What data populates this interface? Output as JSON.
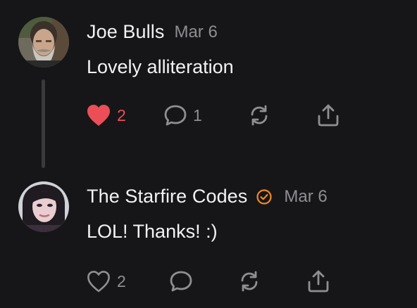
{
  "colors": {
    "background": "#161618",
    "text_primary": "#f3f3f5",
    "text_secondary": "#8e8e93",
    "like_active": "#ec4e57",
    "verified_badge": "#f08a24",
    "thread_line": "#3a3a3d"
  },
  "posts": [
    {
      "author": "Joe Bulls",
      "date": "Mar 6",
      "text": "Lovely alliteration",
      "verified": false,
      "avatar_icon": "bearded-man-avatar",
      "actions": {
        "like": {
          "icon": "heart-filled-icon",
          "count": "2",
          "liked": true
        },
        "reply": {
          "icon": "speech-bubble-icon",
          "count": "1"
        },
        "repost": {
          "icon": "repost-arrows-icon"
        },
        "share": {
          "icon": "share-upload-icon"
        }
      }
    },
    {
      "author": "The Starfire Codes",
      "date": "Mar 6",
      "text": "LOL! Thanks! :)",
      "verified": true,
      "verified_icon": "verified-check-circle-icon",
      "avatar_icon": "woman-dark-hair-avatar",
      "actions": {
        "like": {
          "icon": "heart-outline-icon",
          "count": "2",
          "liked": false
        },
        "reply": {
          "icon": "speech-bubble-icon"
        },
        "repost": {
          "icon": "repost-arrows-icon"
        },
        "share": {
          "icon": "share-upload-icon"
        }
      }
    }
  ]
}
